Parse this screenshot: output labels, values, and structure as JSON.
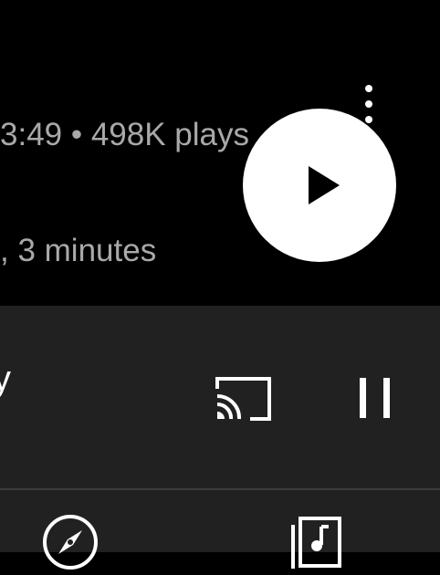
{
  "song": {
    "duration_plays": "3:49 • 498K plays",
    "details": ", 3 minutes"
  },
  "mini_player": {
    "title_fragment": "y"
  },
  "icons": {
    "more": "more-vert-icon",
    "play": "play-icon",
    "cast": "cast-icon",
    "pause": "pause-icon",
    "explore": "compass-icon",
    "library": "library-music-icon"
  },
  "colors": {
    "background": "#000000",
    "mini_player_bg": "#212121",
    "secondary_text": "#a9a9a9"
  }
}
